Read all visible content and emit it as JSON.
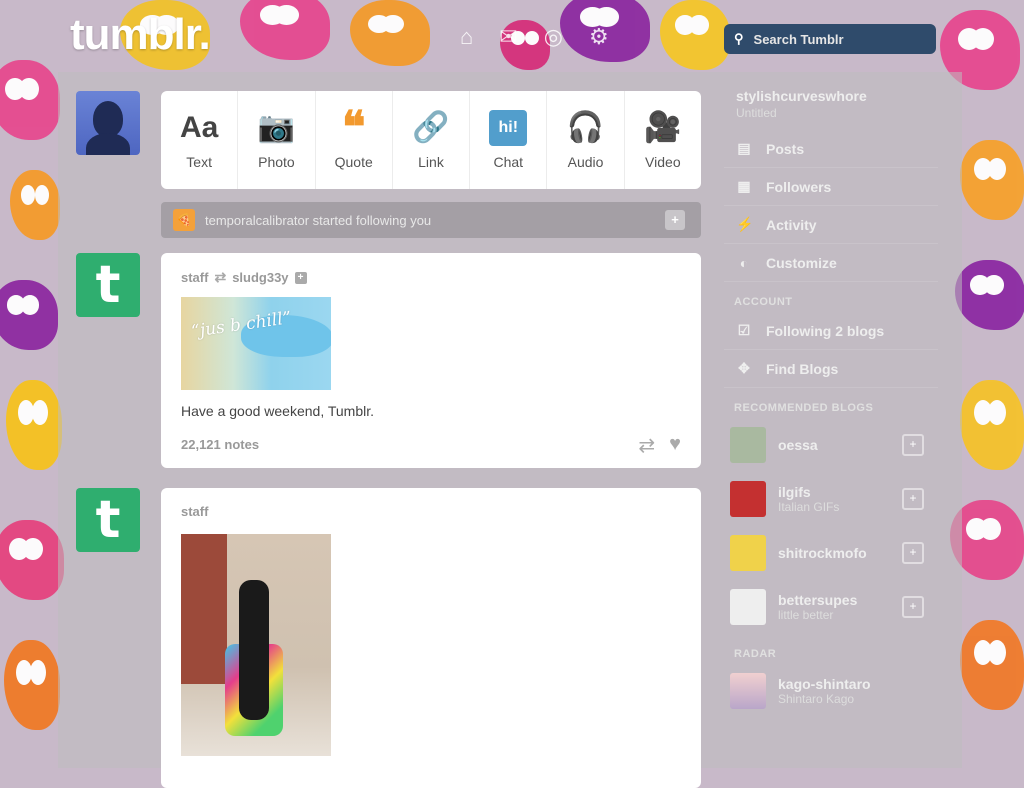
{
  "app": {
    "logo": "tumblr.",
    "search_placeholder": "Search Tumblr"
  },
  "topnav_icons": [
    "home-icon",
    "mail-icon",
    "compass-icon",
    "gear-icon"
  ],
  "post_types": [
    {
      "label": "Text",
      "icon": "Aa",
      "color": "#444444"
    },
    {
      "label": "Photo",
      "icon": "📷",
      "color": "#d95e40"
    },
    {
      "label": "Quote",
      "icon": "❝",
      "color": "#f2992e"
    },
    {
      "label": "Link",
      "icon": "🔗",
      "color": "#56bc8a"
    },
    {
      "label": "Chat",
      "icon": "hi!",
      "color": "#529ecc"
    },
    {
      "label": "Audio",
      "icon": "🎧",
      "color": "#a77dc2"
    },
    {
      "label": "Video",
      "icon": "🎥",
      "color": "#748089"
    }
  ],
  "notification": {
    "text": "temporalcalibrator started following you"
  },
  "posts": [
    {
      "author": "staff",
      "reblog_from": "sludg33y",
      "image_text": "“jus b chill”",
      "caption": "Have a good weekend, Tumblr.",
      "notes": "22,121 notes"
    },
    {
      "author": "staff"
    }
  ],
  "sidebar": {
    "blog_name": "stylishcurveswhore",
    "blog_sub": "Untitled",
    "items": [
      {
        "label": "Posts",
        "icon": "posts-icon"
      },
      {
        "label": "Followers",
        "icon": "followers-icon"
      },
      {
        "label": "Activity",
        "icon": "activity-icon"
      },
      {
        "label": "Customize",
        "icon": "customize-icon"
      }
    ],
    "account_heading": "Account",
    "account_items": [
      {
        "label": "Following 2 blogs",
        "icon": "following-icon"
      },
      {
        "label": "Find Blogs",
        "icon": "find-blogs-icon"
      }
    ],
    "recommended_heading": "Recommended blogs",
    "recommended": [
      {
        "name": "oessa",
        "desc": "",
        "thumb": "#a9b9a0"
      },
      {
        "name": "ilgifs",
        "desc": "Italian GIFs",
        "thumb": "#c43030"
      },
      {
        "name": "shitrockmofo",
        "desc": "",
        "thumb": "#f0d24a"
      },
      {
        "name": "bettersupes",
        "desc": "little better",
        "thumb": "#eeeeee"
      }
    ],
    "radar_heading": "Radar",
    "radar": {
      "name": "kago-shintaro",
      "desc": "Shintaro Kago"
    }
  }
}
